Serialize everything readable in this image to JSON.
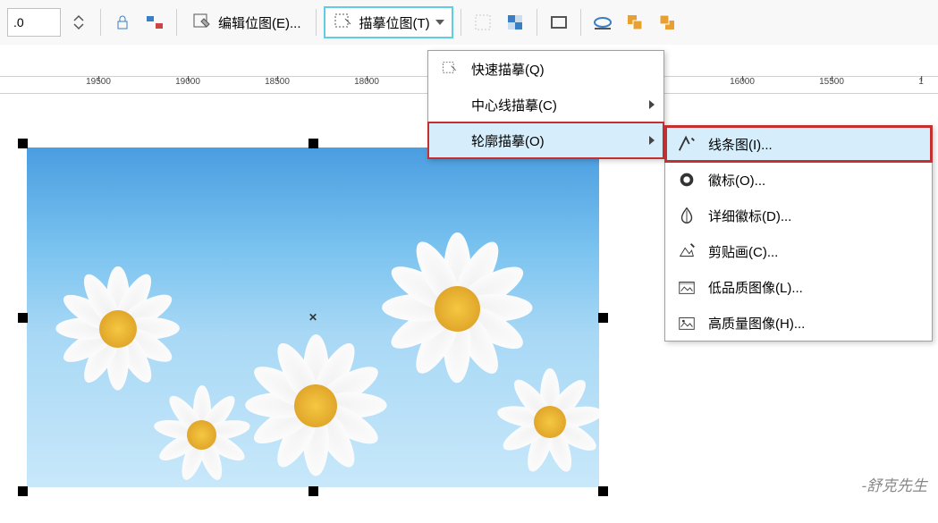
{
  "toolbar": {
    "input_value": ".0",
    "edit_bitmap_label": "编辑位图(E)...",
    "trace_bitmap_label": "描摹位图(T)"
  },
  "ruler": {
    "values": [
      "19500",
      "19000",
      "18500",
      "18000",
      "16000",
      "15500",
      "1"
    ]
  },
  "menu1": {
    "items": [
      {
        "label": "快速描摹(Q)",
        "icon": "quick-trace-icon",
        "has_submenu": false
      },
      {
        "label": "中心线描摹(C)",
        "icon": "",
        "has_submenu": true
      },
      {
        "label": "轮廓描摹(O)",
        "icon": "",
        "has_submenu": true,
        "highlighted": true
      }
    ]
  },
  "menu2": {
    "items": [
      {
        "label": "线条图(I)...",
        "icon": "line-art-icon",
        "highlighted": true
      },
      {
        "label": "徽标(O)...",
        "icon": "logo-icon"
      },
      {
        "label": "详细徽标(D)...",
        "icon": "detailed-logo-icon"
      },
      {
        "label": "剪贴画(C)...",
        "icon": "clipart-icon"
      },
      {
        "label": "低品质图像(L)...",
        "icon": "low-quality-icon"
      },
      {
        "label": "高质量图像(H)...",
        "icon": "high-quality-icon"
      }
    ]
  },
  "watermark": "-舒克先生"
}
